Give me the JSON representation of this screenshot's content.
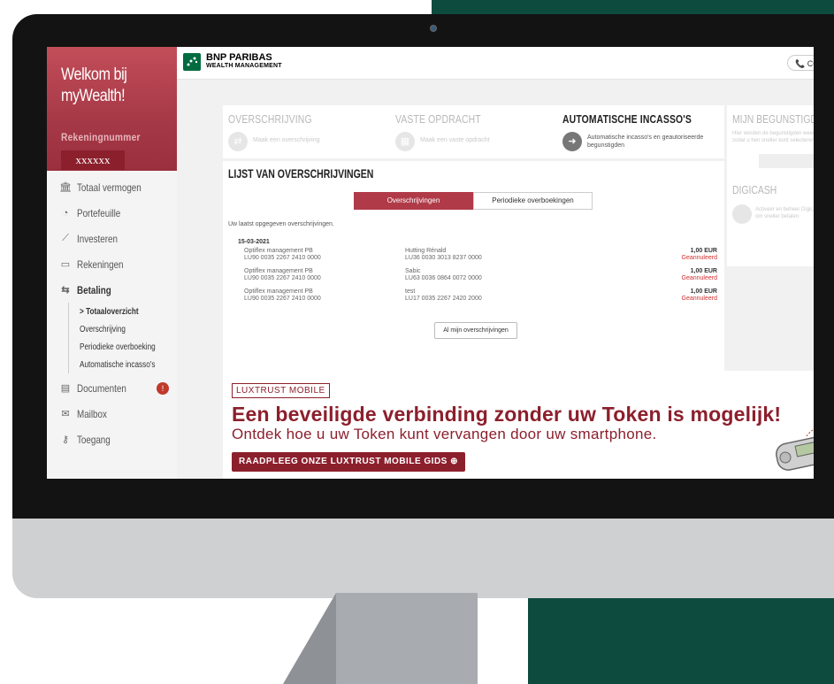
{
  "sidebar": {
    "welcome": "Welkom bij myWealth!",
    "account_label": "Rekeningnummer",
    "account_number": "xxxxxx",
    "items": [
      {
        "label": "Totaal vermogen",
        "icon": "bank-icon"
      },
      {
        "label": "Portefeuille",
        "icon": "pie-chart-icon"
      },
      {
        "label": "Investeren",
        "icon": "line-chart-icon"
      },
      {
        "label": "Rekeningen",
        "icon": "card-icon"
      },
      {
        "label": "Betaling",
        "icon": "transfer-icon"
      }
    ],
    "sub_items": [
      "> Totaaloverzicht",
      "Overschrijving",
      "Periodieke overboeking",
      "Automatische incasso's"
    ],
    "bottom_items": [
      {
        "label": "Documenten",
        "icon": "document-icon",
        "badge": "!"
      },
      {
        "label": "Mailbox",
        "icon": "mail-icon"
      },
      {
        "label": "Toegang",
        "icon": "key-icon"
      }
    ]
  },
  "header": {
    "brand_line1": "BNP PARIBAS",
    "brand_line2": "WEALTH MANAGEMENT",
    "contact_label": "CO"
  },
  "actions": [
    {
      "title": "OVERSCHRIJVING",
      "desc": "Maak een overschrijving"
    },
    {
      "title": "VASTE OPDRACHT",
      "desc": "Maak een vaste opdracht"
    },
    {
      "title": "AUTOMATISCHE INCASSO'S",
      "desc": "Automatische incasso's en geautoriseerde begunstigden"
    }
  ],
  "right_panel": {
    "title": "MIJN BEGUNSTIGDEN",
    "text": "Hier worden de begunstigden weergegeven, zodat u hen sneller kunt selecteren",
    "title2": "DIGICASH",
    "text2": "Activeer en beheer Digicash om sneller betalen"
  },
  "list": {
    "title": "LIJST VAN OVERSCHRIJVINGEN",
    "tabs": [
      "Overschrijvingen",
      "Periodieke overboekingen"
    ],
    "intro": "Uw laatst opgegeven overschrijvingen.",
    "date": "15-03-2021",
    "rows": [
      {
        "from_name": "Optiflex management PB",
        "from_iban": "LU90 0035 2267 2410 0000",
        "to_name": "Hutting Rénald",
        "to_iban": "LU36 0030 3013 8237 0000",
        "amount": "1,00 EUR",
        "status": "Geannuleerd"
      },
      {
        "from_name": "Optiflex management PB",
        "from_iban": "LU90 0035 2267 2410 0000",
        "to_name": "Sabic",
        "to_iban": "LU63 0036 0864 0072 0000",
        "amount": "1,00 EUR",
        "status": "Geannuleerd"
      },
      {
        "from_name": "Optiflex management PB",
        "from_iban": "LU90 0035 2267 2410 0000",
        "to_name": "test",
        "to_iban": "LU17 0035 2267 2420 2000",
        "amount": "1,00 EUR",
        "status": "Geannuleerd"
      }
    ],
    "all_button": "Al mijn overschrijvingen"
  },
  "banner": {
    "tag": "LUXTRUST MOBILE",
    "headline": "Een beveiligde verbinding zonder uw Token is mogelijk!",
    "sub": "Ontdek hoe u uw Token kunt vervangen door uw smartphone.",
    "button": "RAADPLEEG ONZE LUXTRUST MOBILE GIDS"
  },
  "colors": {
    "brand_red": "#8c1f2c",
    "sidebar_red": "#b03a48",
    "green_bg": "#0e4b3f",
    "status_red": "#d32f2f"
  }
}
